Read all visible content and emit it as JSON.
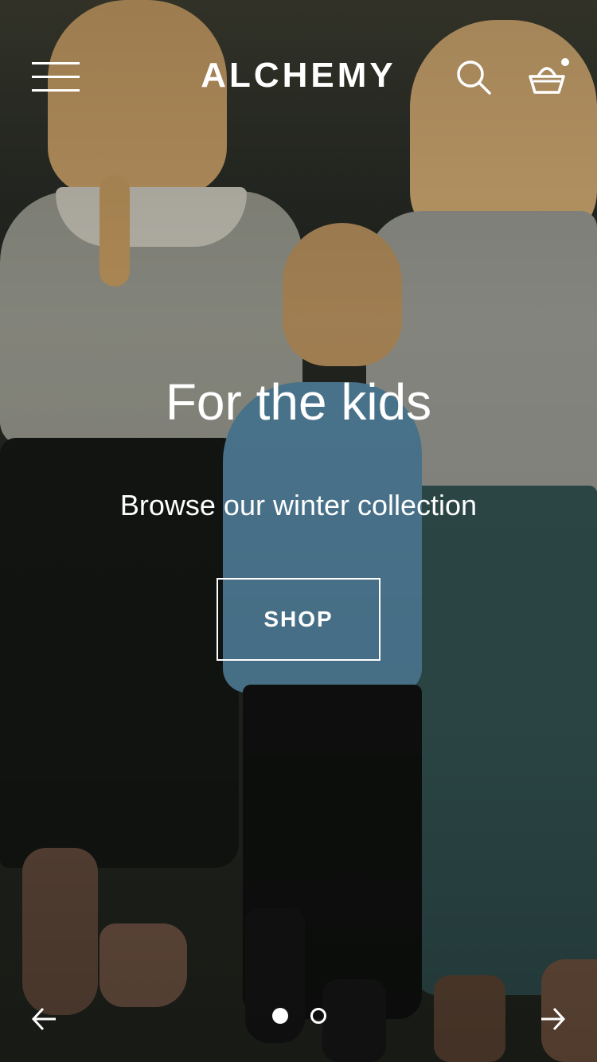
{
  "header": {
    "logo": "ALCHEMY",
    "menu_icon": "hamburger-menu-icon",
    "search_icon": "search-icon",
    "cart_icon": "shopping-basket-icon",
    "cart_has_items": true
  },
  "hero": {
    "title": "For the kids",
    "subtitle": "Browse our winter collection",
    "cta_label": "SHOP"
  },
  "carousel": {
    "prev_icon": "arrow-left-icon",
    "next_icon": "arrow-right-icon",
    "slides": 2,
    "active_slide": 1
  },
  "colors": {
    "text": "#ffffff",
    "background": "#1d2018"
  }
}
